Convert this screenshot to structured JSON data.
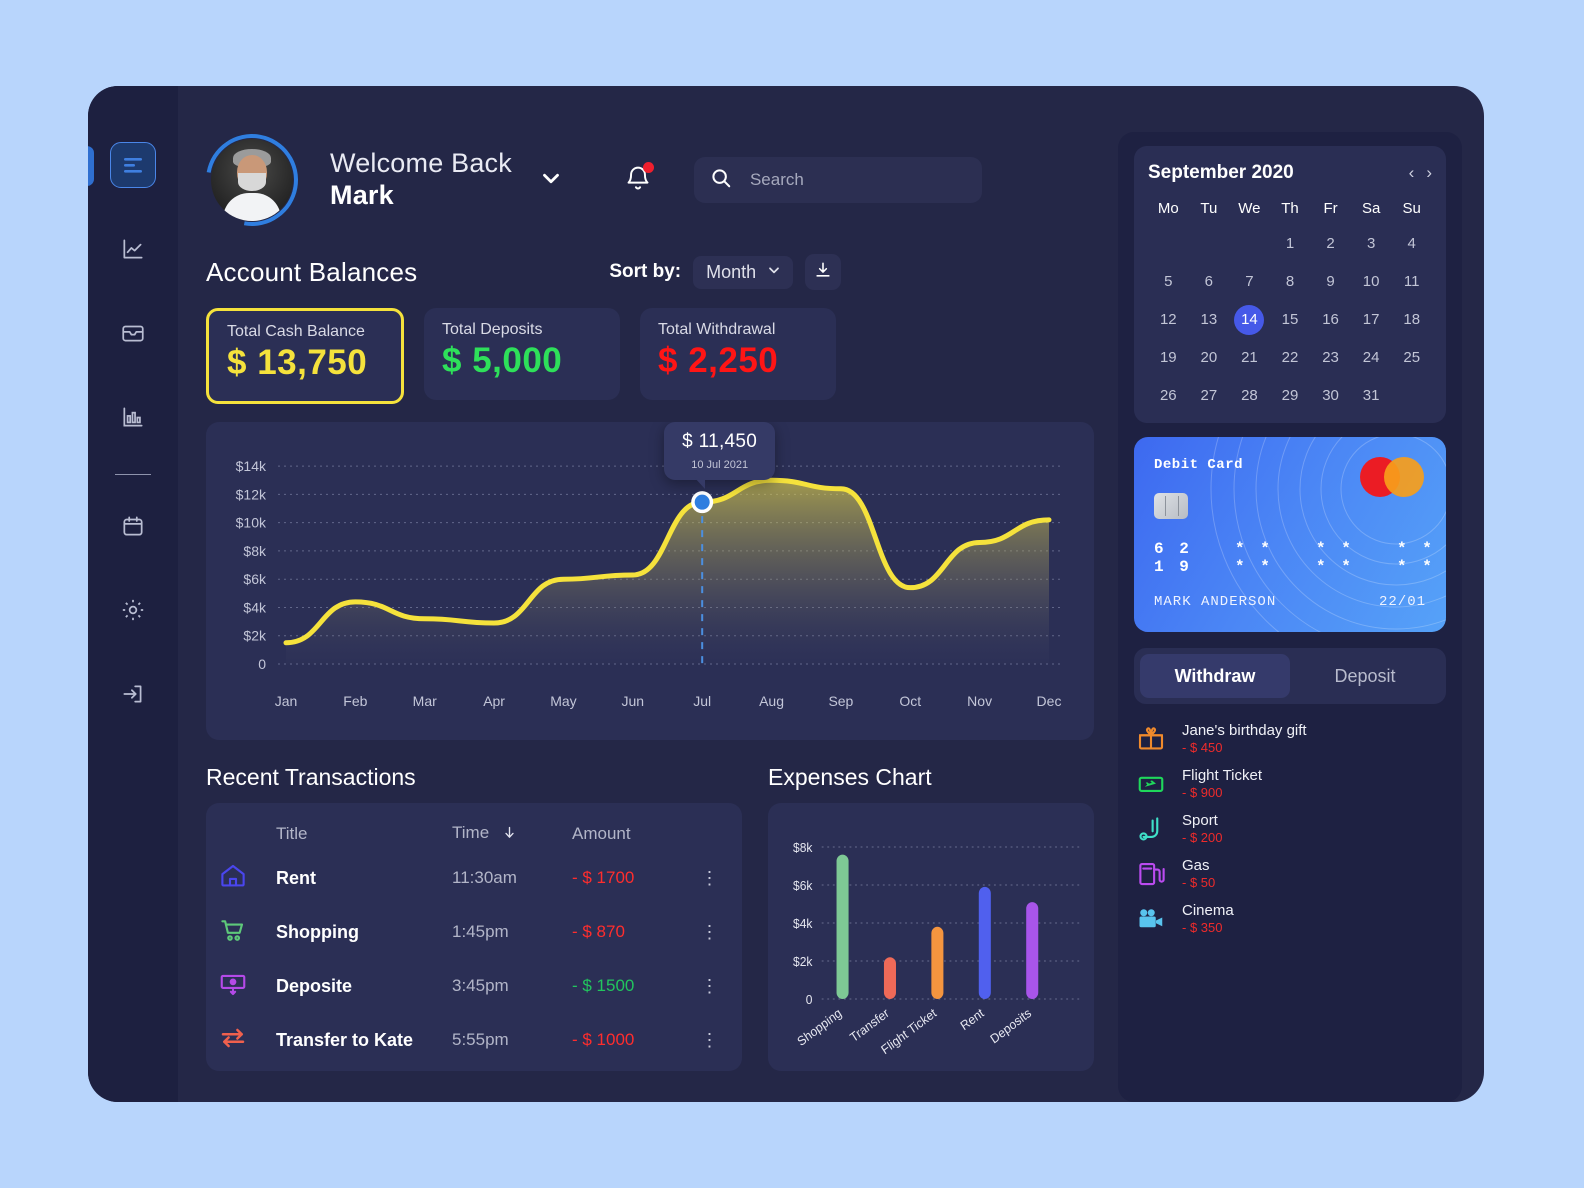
{
  "header": {
    "welcome_line1": "Welcome Back",
    "welcome_line2": "Mark",
    "search_placeholder": "Search",
    "search_value": ""
  },
  "section": {
    "title": "Account Balances",
    "sort_label": "Sort by:",
    "sort_value": "Month"
  },
  "balances": [
    {
      "label": "Total Cash Balance",
      "value": "$ 13,750",
      "color": "#f5e23c",
      "highlight": true
    },
    {
      "label": "Total Deposits",
      "value": "$ 5,000",
      "color": "#2ee05a",
      "highlight": false
    },
    {
      "label": "Total Withdrawal",
      "value": "$ 2,250",
      "color": "#ff1515",
      "highlight": false
    }
  ],
  "tooltip": {
    "value": "$ 11,450",
    "date": "10 Jul 2021"
  },
  "transactions": {
    "title": "Recent Transactions",
    "columns": {
      "title": "Title",
      "time": "Time",
      "amount": "Amount"
    },
    "sort_icon": "arrow-down-icon",
    "rows": [
      {
        "icon": "home-icon",
        "title": "Rent",
        "time": "11:30am",
        "amount": "- $ 1700",
        "color": "#ff2d2d"
      },
      {
        "icon": "cart-icon",
        "title": "Shopping",
        "time": "1:45pm",
        "amount": "- $ 870",
        "color": "#ff2d2d"
      },
      {
        "icon": "cash-icon",
        "title": "Deposite",
        "time": "3:45pm",
        "amount": "- $ 1500",
        "color": "#22c55e"
      },
      {
        "icon": "transfer-icon",
        "title": "Transfer to Kate",
        "time": "5:55pm",
        "amount": "- $ 1000",
        "color": "#ff2d2d"
      }
    ]
  },
  "calendar": {
    "title": "September 2020",
    "prev": "‹",
    "next": "›",
    "dow": [
      "Mo",
      "Tu",
      "We",
      "Th",
      "Fr",
      "Sa",
      "Su"
    ],
    "blanks": 3,
    "days": [
      1,
      2,
      3,
      4,
      5,
      6,
      7,
      8,
      9,
      10,
      11,
      12,
      13,
      14,
      15,
      16,
      17,
      18,
      19,
      20,
      21,
      22,
      23,
      24,
      25,
      26,
      27,
      28,
      29,
      30,
      31
    ],
    "selected": 14
  },
  "debit_card": {
    "label": "Debit Card",
    "digits": [
      "6 2 1 9",
      "* * * *",
      "* * * *",
      "* * * *"
    ],
    "holder": "MARK ANDERSON",
    "expiry": "22/01",
    "brand": "mastercard"
  },
  "toggle": {
    "active": "Withdraw",
    "inactive": "Deposit"
  },
  "expense_list": [
    {
      "icon": "gift-icon",
      "name": "Jane's birthday gift",
      "amount": "- $ 450",
      "color": "#f08a2c"
    },
    {
      "icon": "ticket-icon",
      "name": "Flight Ticket",
      "amount": "- $ 900",
      "color": "#1fd75b"
    },
    {
      "icon": "sport-icon",
      "name": "Sport",
      "amount": "- $ 200",
      "color": "#3fe0c8"
    },
    {
      "icon": "gas-icon",
      "name": "Gas",
      "amount": "- $ 50",
      "color": "#bb4bf0"
    },
    {
      "icon": "cinema-icon",
      "name": "Cinema",
      "amount": "- $ 350",
      "color": "#59c4ee"
    }
  ],
  "sidebar": {
    "items": [
      {
        "icon": "menu-icon",
        "active": true
      },
      {
        "icon": "line-chart-icon",
        "active": false
      },
      {
        "icon": "wallet-icon",
        "active": false
      },
      {
        "icon": "bar-chart-icon",
        "active": false
      },
      {
        "icon": "calendar-icon",
        "active": false
      },
      {
        "icon": "gear-icon",
        "active": false
      },
      {
        "icon": "logout-icon",
        "active": false
      }
    ]
  },
  "chart_data": [
    {
      "type": "area",
      "title": "Account Balances",
      "categories": [
        "Jan",
        "Feb",
        "Mar",
        "Apr",
        "May",
        "Jun",
        "Jul",
        "Aug",
        "Sep",
        "Oct",
        "Nov",
        "Dec"
      ],
      "values": [
        1500,
        4400,
        3200,
        2900,
        6000,
        6300,
        11450,
        13000,
        12400,
        5400,
        8600,
        10200
      ],
      "yticks": [
        "0",
        "$2k",
        "$4k",
        "$6k",
        "$8k",
        "$10k",
        "$12k",
        "$14k"
      ],
      "ylim": [
        0,
        15000
      ],
      "xlabel": "",
      "ylabel": "",
      "grid": true,
      "line_color": "#f5e23c",
      "marker": {
        "x": "Jul",
        "value": 11450,
        "label": "$ 11,450",
        "date": "10 Jul 2021"
      }
    },
    {
      "type": "bar",
      "title": "Expenses Chart",
      "categories": [
        "Shopping",
        "Transfer",
        "Flight Ticket",
        "Rent",
        "Deposits"
      ],
      "values": [
        7600,
        2200,
        3800,
        5900,
        5100
      ],
      "colors": [
        "#7ec995",
        "#ef6a58",
        "#f5953f",
        "#5060ee",
        "#a855ea"
      ],
      "yticks": [
        "0",
        "$2k",
        "$4k",
        "$6k",
        "$8k"
      ],
      "ylim": [
        0,
        8000
      ],
      "xlabel": "",
      "ylabel": "",
      "grid": true
    }
  ]
}
